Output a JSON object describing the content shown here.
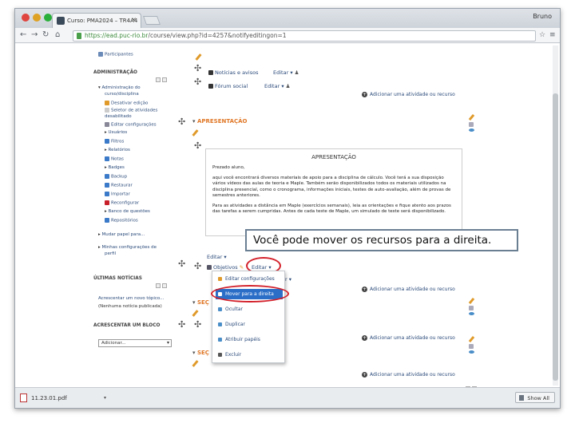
{
  "browser": {
    "tab_title": "Curso: PMA2024 – TR4A4",
    "profile_name": "Bruno",
    "url_secure": "https://ead.puc-rio.br",
    "url_rest": "/course/view.php?id=4257&notifyeditingon=1"
  },
  "sidebar": {
    "top_link": "Participantes",
    "admin_header": "ADMINISTRAÇÃO",
    "admin_items": [
      "Administração do",
      "curso/disciplina",
      "Desativar edição",
      "Seletor de atividades",
      "desabilitado",
      "Editar configurações",
      "Usuários",
      "Filtros",
      "Relatórios",
      "Notas",
      "Badges",
      "Backup",
      "Restaurar",
      "Importar",
      "Reconfigurar",
      "Banco de questões",
      "Repositórios",
      "Mudar papel para...",
      "Minhas configurações de",
      "perfil"
    ],
    "news_header": "ÚLTIMAS NOTÍCIAS",
    "news_items": [
      "Acrescentar um novo tópico...",
      "(Nenhuma notícia publicada)"
    ],
    "add_block_header": "ACRESCENTAR UM BLOCO",
    "add_block_select": "Adicionar..."
  },
  "main": {
    "forum_news": "Notícias e avisos",
    "forum_social": "Fórum social",
    "edit_label": "Editar",
    "add_activity": "Adicionar uma atividade ou recurso",
    "section_title": "APRESENTAÇÃO",
    "section2_prefix": "SEÇ",
    "info_heading": "APRESENTAÇÃO",
    "info_p1": "Prezado aluno,",
    "info_p2": "aqui você encontrará diversos materiais de apoio para a disciplina de cálculo. Você terá a sua disposição vários vídeos das aulas de teoria e Maple. Também serão disponibilizados todos os materiais utilizados na disciplina presencial, como o cronograma, informações iniciais, testes de auto-avaliação, além de provas de semestres anteriores.",
    "info_p3": "Para as atividades a distância em Maple (exercícios semanais), leia as orientações e fique atento aos prazos das tarefas a serem cumpridas. Antes de cada teste de Maple, um simulado de teste será disponibilizado.",
    "objectives": "Objetivos",
    "callout": "Você pode mover os recursos para a direita.",
    "context_menu": [
      "Editar configurações",
      "Mover para a direita",
      "Ocultar",
      "Duplicar",
      "Atribuir papéis",
      "Excluir"
    ]
  },
  "downloads": {
    "file_name": "11.23.01.pdf",
    "show_all": "Show All"
  }
}
